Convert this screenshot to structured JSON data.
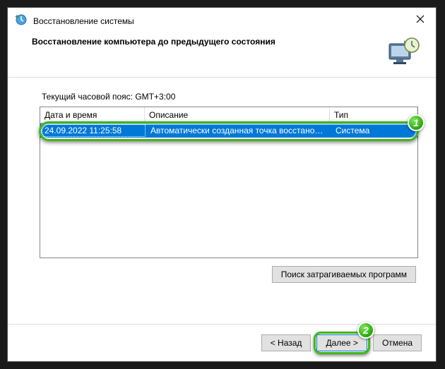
{
  "window": {
    "title": "Восстановление системы"
  },
  "header": {
    "text": "Восстановление компьютера до предыдущего состояния"
  },
  "content": {
    "timezone_label": "Текущий часовой пояс: GMT+3:00",
    "columns": {
      "datetime": "Дата и время",
      "description": "Описание",
      "type": "Тип"
    },
    "row": {
      "datetime": "24.09.2022 11:25:58",
      "description": "Автоматически созданная точка восстановле...",
      "type": "Система"
    },
    "affected_programs_btn": "Поиск затрагиваемых программ"
  },
  "footer": {
    "back": "< Назад",
    "next": "Далее >",
    "cancel": "Отмена"
  },
  "annotations": {
    "badge1": "1",
    "badge2": "2"
  }
}
